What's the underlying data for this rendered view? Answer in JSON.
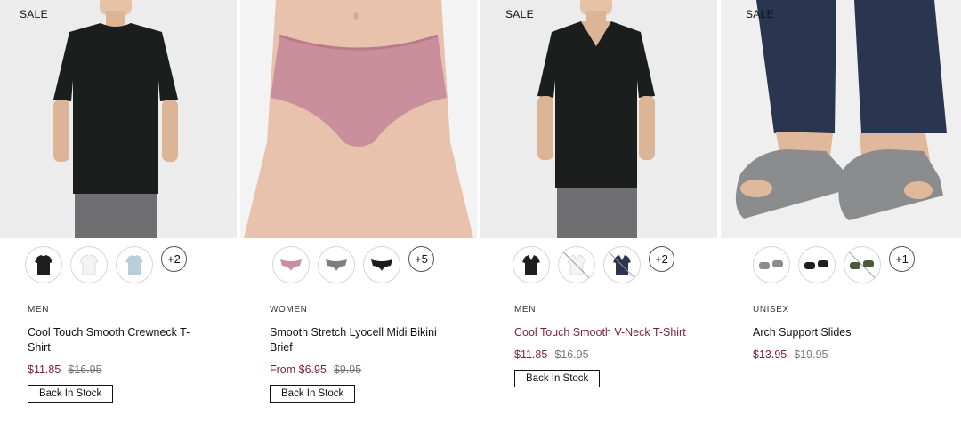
{
  "products": [
    {
      "badge": "SALE",
      "extra_colors": "+2",
      "category": "MEN",
      "name": "Cool Touch Smooth Crewneck T-Shirt",
      "price": "$11.85",
      "original_price": "$16.95",
      "cta": "Back In Stock"
    },
    {
      "extra_colors": "+5",
      "category": "WOMEN",
      "name": "Smooth Stretch Lyocell Midi Bikini Brief",
      "price": "From $6.95",
      "original_price": "$9.95",
      "cta": "Back In Stock"
    },
    {
      "badge": "SALE",
      "extra_colors": "+2",
      "category": "MEN",
      "name": "Cool Touch Smooth V-Neck T-Shirt",
      "price": "$11.85",
      "original_price": "$16.95",
      "cta": "Back In Stock"
    },
    {
      "badge": "SALE",
      "extra_colors": "+1",
      "category": "UNISEX",
      "name": "Arch Support Slides",
      "price": "$13.95",
      "original_price": "$19.95"
    }
  ],
  "colors": {
    "sale_price": "#7a1f3d",
    "image_bg": "#ececec"
  }
}
